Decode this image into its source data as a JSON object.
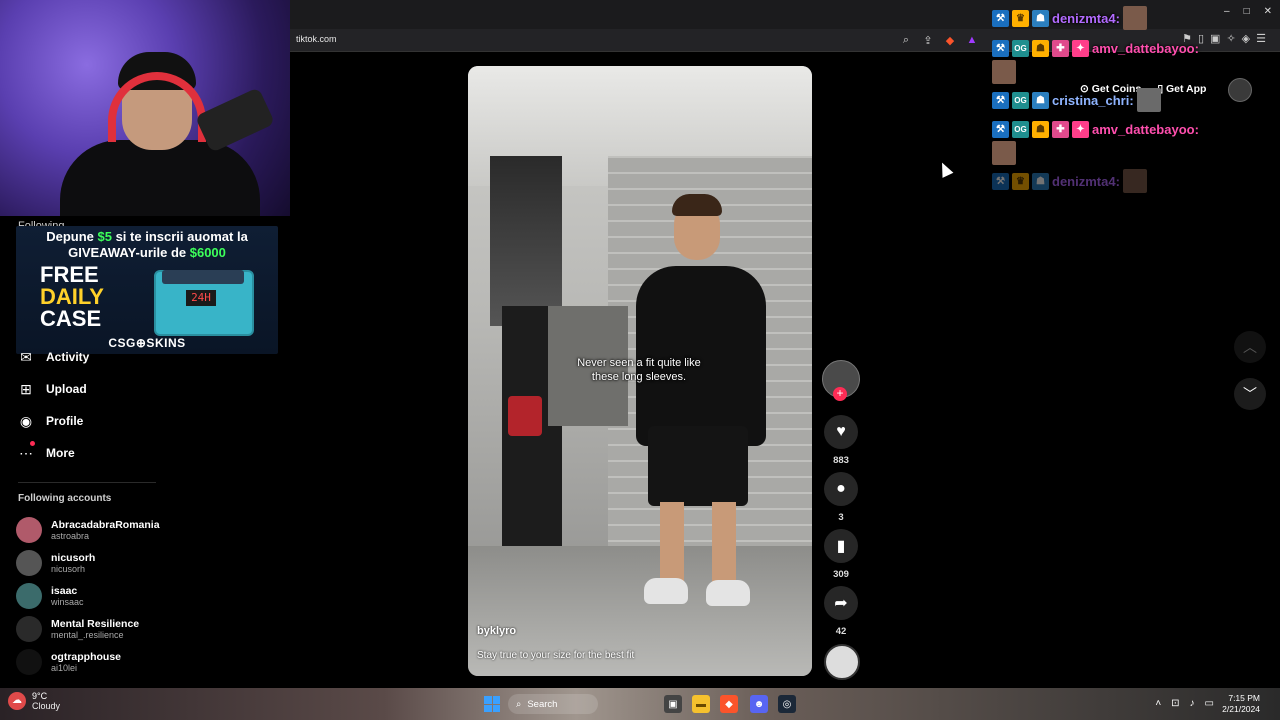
{
  "browser": {
    "url": "tiktok.com",
    "window_controls": [
      "–",
      "□",
      "✕"
    ]
  },
  "ad": {
    "line1_a": "Depune ",
    "line1_amount": "$5",
    "line1_b": " si te inscrii auomat la",
    "line2_a": "GIVEAWAY-urile de ",
    "line2_amount": "$6000",
    "free": "FREE",
    "daily": "DAILY",
    "case": "CASE",
    "timer": "24H",
    "logo": "CSG⊕SKINS"
  },
  "sidebar": {
    "following_partial": "Following",
    "nav": [
      {
        "label": "Activity",
        "icon": "inbox-icon"
      },
      {
        "label": "Upload",
        "icon": "upload-icon"
      },
      {
        "label": "Profile",
        "icon": "profile-icon"
      },
      {
        "label": "More",
        "icon": "more-icon"
      }
    ],
    "following_title": "Following accounts",
    "accounts": [
      {
        "name": "AbracadabraRomania",
        "handle": "astroabra",
        "color": "#b05a6a"
      },
      {
        "name": "nicusorh",
        "handle": "nicusorh",
        "color": "#555555"
      },
      {
        "name": "isaac",
        "handle": "winsaac",
        "color": "#3b6b6b"
      },
      {
        "name": "Mental Resilience",
        "handle": "mental_.resilience",
        "color": "#2a2a2a"
      },
      {
        "name": "ogtrapphouse",
        "handle": "ai10lei",
        "color": "#111111"
      }
    ]
  },
  "video": {
    "caption_line1": "Never seen a fit quite like",
    "caption_line2": "these long sleeves.",
    "author": "byklyro",
    "description": "Stay true to your size for the best fit"
  },
  "actions": {
    "likes": "883",
    "comments": "3",
    "bookmarks": "309",
    "shares": "42"
  },
  "top_right": {
    "get_coins": "Get Coins",
    "get_app": "Get App"
  },
  "chat": [
    {
      "user": "denizmta4:",
      "color": "#b36bff",
      "dim": false
    },
    {
      "user": "amv_dattebayoo:",
      "color": "#ff4fae",
      "dim": false
    },
    {
      "user": "cristina_chri:",
      "color": "#8fb4ff",
      "dim": false
    },
    {
      "user": "amv_dattebayoo:",
      "color": "#ff4fae",
      "dim": false
    },
    {
      "user": "denizmta4:",
      "color": "#b36bff",
      "dim": true
    }
  ],
  "taskbar": {
    "temp": "9°C",
    "condition": "Cloudy",
    "search": "Search",
    "time": "7:15 PM",
    "date": "2/21/2024"
  }
}
